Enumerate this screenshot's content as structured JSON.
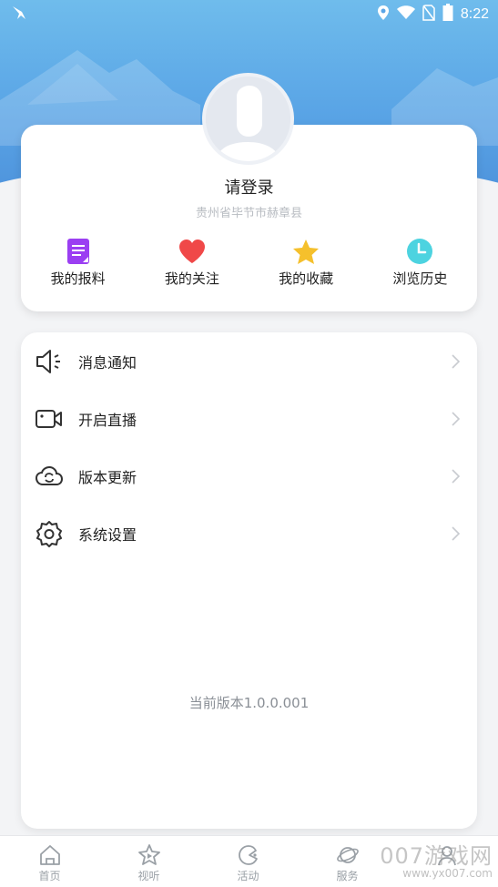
{
  "status_bar": {
    "time": "8:22",
    "icons": [
      "app-notification-icon",
      "location-icon",
      "wifi-icon",
      "no-sim-icon",
      "battery-icon"
    ]
  },
  "profile": {
    "login_label": "请登录",
    "location": "贵州省毕节市赫章县",
    "quick_actions": [
      {
        "label": "我的报料",
        "icon": "report-document-icon",
        "color": "#9b3ff2"
      },
      {
        "label": "我的关注",
        "icon": "heart-icon",
        "color": "#f04848"
      },
      {
        "label": "我的收藏",
        "icon": "star-icon",
        "color": "#f5c02c"
      },
      {
        "label": "浏览历史",
        "icon": "clock-icon",
        "color": "#4dd3e0"
      }
    ]
  },
  "menu": {
    "items": [
      {
        "label": "消息通知",
        "icon": "speaker-icon"
      },
      {
        "label": "开启直播",
        "icon": "video-camera-icon"
      },
      {
        "label": "版本更新",
        "icon": "cloud-sync-icon"
      },
      {
        "label": "系统设置",
        "icon": "gear-icon"
      }
    ],
    "version_text": "当前版本1.0.0.001"
  },
  "tabbar": {
    "tabs": [
      {
        "label": "首页",
        "icon": "home-icon"
      },
      {
        "label": "视听",
        "icon": "play-star-icon"
      },
      {
        "label": "活动",
        "icon": "activity-icon"
      },
      {
        "label": "服务",
        "icon": "planet-icon"
      },
      {
        "label": "",
        "icon": "profile-icon"
      }
    ]
  },
  "watermark": {
    "text": "007游戏网",
    "url_text": "www.yx007.com"
  },
  "colors": {
    "header_gradient_top": "#6fbcec",
    "header_gradient_bottom": "#4e93dc",
    "background": "#f3f4f6"
  }
}
